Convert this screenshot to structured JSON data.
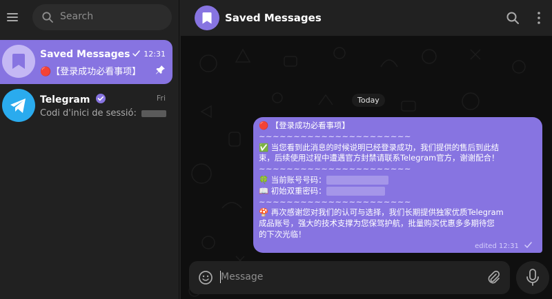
{
  "sidebar": {
    "search_placeholder": "Search",
    "chats": [
      {
        "title": "Saved Messages",
        "time": "12:31",
        "preview": "🔴【登录成功必看事项】",
        "active": true
      },
      {
        "title": "Telegram",
        "time": "Fri",
        "preview": "Codi d'inici de sessió:",
        "verified": true
      }
    ]
  },
  "header": {
    "title": "Saved Messages"
  },
  "chat": {
    "date_label": "Today",
    "message": {
      "line1": "🔴 【登录成功必看事项】",
      "sep": "~~~~~~~~~~~~~~~~~~~~~~",
      "line2a": "✅ 当您看到此消息的时候说明已经登录成功，我们提供的售后到此结",
      "line2b": "束，后续使用过程中遭遇官方封禁请联系Telegram官方，谢谢配合！",
      "line3": "🍀 当前账号号码：",
      "line4": "📖 初始双重密码：",
      "line5a": "🍄 再次感谢您对我们的认可与选择，我们长期提供独家优质Telegram",
      "line5b": "成品账号，强大的技术支撑为您保驾护航，批量购买优惠多多期待您",
      "line5c": "的下次光临！",
      "status": "edited 12:31"
    },
    "composer_placeholder": "Message"
  },
  "colors": {
    "accent": "#8774e1",
    "telegram_blue": "#2aabee",
    "background": "#0f0f0f",
    "panel": "#212121"
  },
  "icons": [
    "menu-icon",
    "search-icon",
    "bookmark-icon",
    "paper-plane-icon",
    "verified-badge-icon",
    "pin-icon",
    "double-check-icon",
    "more-icon",
    "smile-icon",
    "paperclip-icon",
    "microphone-icon"
  ]
}
